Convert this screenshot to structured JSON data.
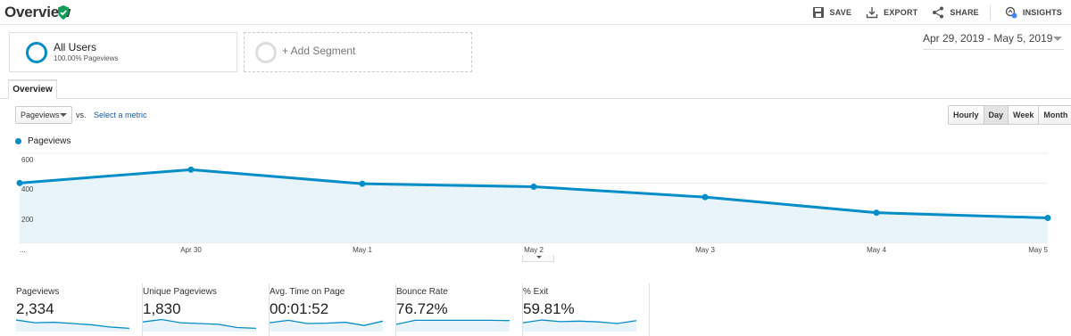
{
  "header": {
    "title": "Overview",
    "actions": [
      {
        "label": "SAVE",
        "icon": "save-icon"
      },
      {
        "label": "EXPORT",
        "icon": "export-icon"
      },
      {
        "label": "SHARE",
        "icon": "share-icon"
      },
      {
        "label": "INSIGHTS",
        "icon": "insights-icon"
      }
    ]
  },
  "segments": {
    "all": {
      "name": "All Users",
      "sub": "100.00% Pageviews"
    },
    "add": {
      "label": "+ Add Segment"
    }
  },
  "date_range": "Apr 29, 2019 - May 5, 2019",
  "tabs": [
    {
      "label": "Overview"
    }
  ],
  "controls": {
    "metric": "Pageviews",
    "vs": "vs.",
    "select_metric": "Select a metric",
    "granularity": [
      "Hourly",
      "Day",
      "Week",
      "Month"
    ],
    "active_granularity": "Day"
  },
  "legend": {
    "series": "Pageviews"
  },
  "colors": {
    "accent": "#058dc7",
    "fill": "#e8f4fa"
  },
  "chart_data": {
    "type": "area",
    "x": [
      "...",
      "Apr 30",
      "May 1",
      "May 2",
      "May 3",
      "May 4",
      "May 5"
    ],
    "series": [
      {
        "name": "Pageviews",
        "values": [
          400,
          490,
          395,
          375,
          305,
          200,
          165
        ]
      }
    ],
    "yticks": [
      "600",
      "400",
      "200"
    ],
    "ylim": [
      0,
      600
    ],
    "grid": true
  },
  "scorecards": [
    {
      "label": "Pageviews",
      "value": "2,334",
      "spark": [
        0.72,
        0.55,
        0.58,
        0.5,
        0.42,
        0.28,
        0.2
      ]
    },
    {
      "label": "Unique Pageviews",
      "value": "1,830",
      "spark": [
        0.6,
        0.75,
        0.55,
        0.5,
        0.45,
        0.25,
        0.2
      ]
    },
    {
      "label": "Avg. Time on Page",
      "value": "00:01:52",
      "spark": [
        0.55,
        0.7,
        0.5,
        0.52,
        0.58,
        0.38,
        0.65
      ]
    },
    {
      "label": "Bounce Rate",
      "value": "76.72%",
      "spark": [
        0.45,
        0.7,
        0.7,
        0.7,
        0.7,
        0.7,
        0.68
      ]
    },
    {
      "label": "% Exit",
      "value": "59.81%",
      "spark": [
        0.55,
        0.72,
        0.62,
        0.65,
        0.6,
        0.5,
        0.68
      ]
    }
  ]
}
